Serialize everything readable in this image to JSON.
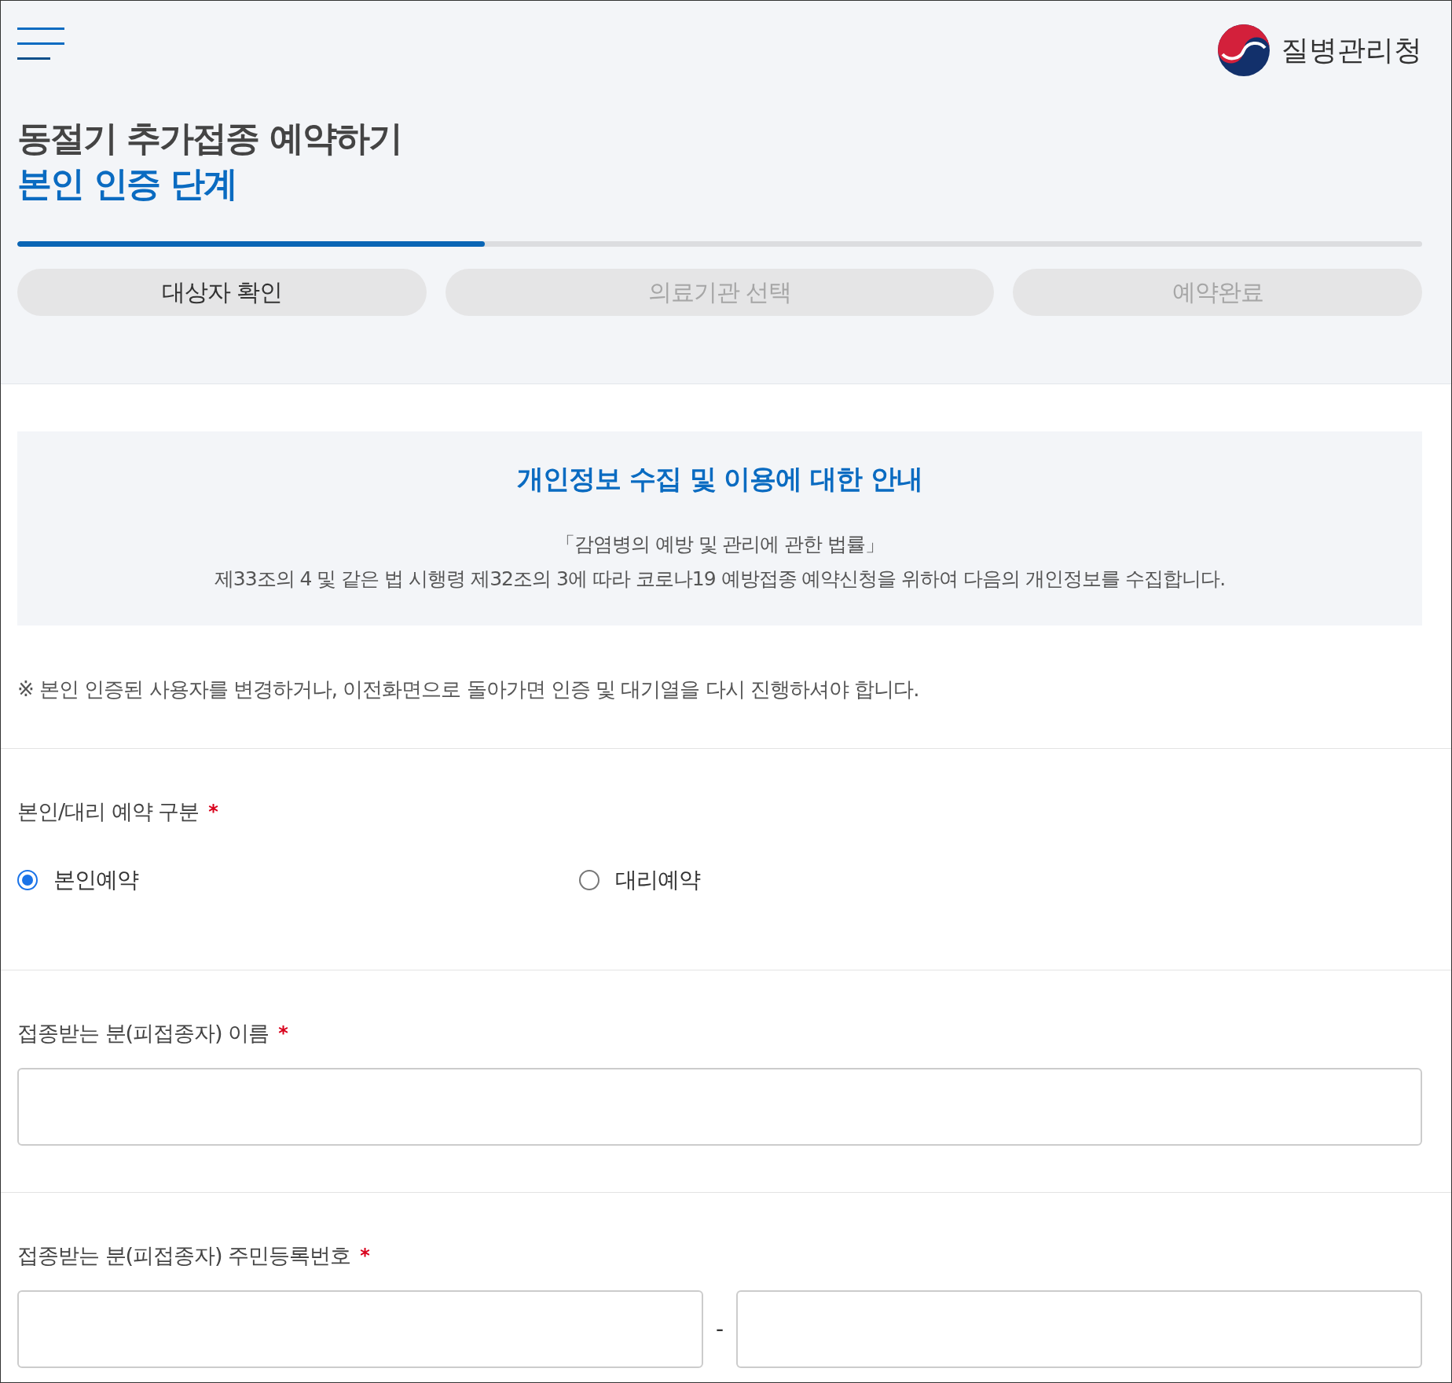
{
  "header": {
    "logo_text": "질병관리청",
    "title": "동절기 추가접종 예약하기",
    "subtitle": "본인 인증 단계"
  },
  "progress": {
    "level": 0.333
  },
  "steps": [
    {
      "label": "대상자 확인",
      "selected": true
    },
    {
      "label": "의료기관 선택",
      "selected": false
    },
    {
      "label": "예약완료",
      "selected": false
    }
  ],
  "notice": {
    "title": "개인정보 수집 및 이용에 대한 안내",
    "lines": [
      "「감염병의 예방 및 관리에 관한 법률」",
      "제33조의 4 및 같은 법 시행령 제32조의 3에 따라 코로나19 예방접종 예약신청을 위하여 다음의 개인정보를 수집합니다."
    ]
  },
  "warning": "※ 본인 인증된 사용자를 변경하거나, 이전화면으로 돌아가면 인증 및 대기열을 다시 진행하셔야 합니다.",
  "booking_type": {
    "label": "본인/대리 예약 구분",
    "required_mark": "*",
    "options": [
      {
        "label": "본인예약",
        "checked": true
      },
      {
        "label": "대리예약",
        "checked": false
      }
    ]
  },
  "name_field": {
    "label": "접종받는 분(피접종자) 이름",
    "required_mark": "*"
  },
  "id_field": {
    "label": "접종받는 분(피접종자) 주민등록번호",
    "required_mark": "*",
    "separator": "-"
  }
}
